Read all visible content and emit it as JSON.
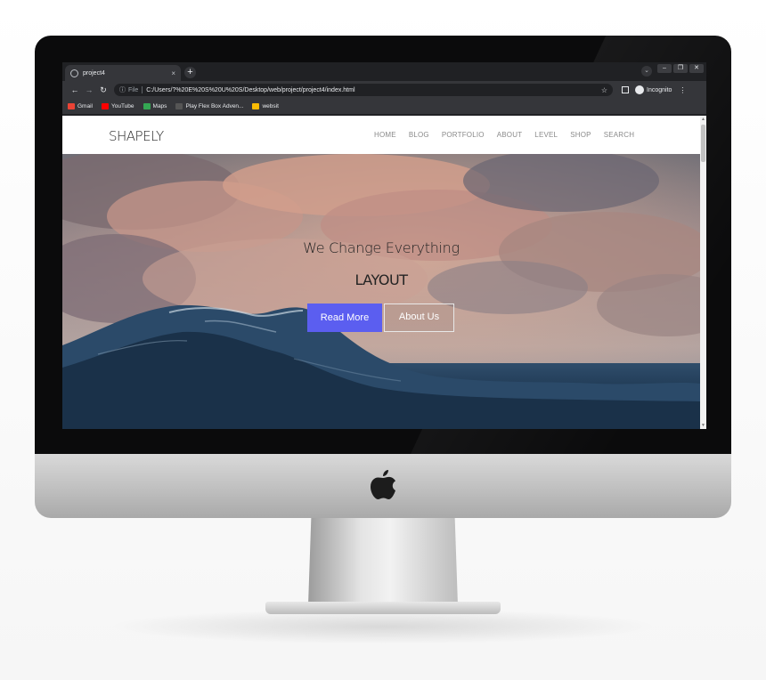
{
  "browser": {
    "tab_title": "project4",
    "tab_close": "×",
    "new_tab": "+",
    "file_label": "File",
    "url": "C:/Users/?%20E%20S%20U%20S/Desktop/web/project/project4/index.html",
    "profile_label": "Incognito",
    "bookmarks": [
      {
        "label": "Gmail",
        "color": "#ea4335"
      },
      {
        "label": "YouTube",
        "color": "#ff0000"
      },
      {
        "label": "Maps",
        "color": "#34a853"
      },
      {
        "label": "Play Flex Box Adven...",
        "color": "#3b3b3b"
      },
      {
        "label": "websit",
        "color": "#fbbc04"
      }
    ]
  },
  "site": {
    "logo": "SHAPELY",
    "nav": [
      "HOME",
      "BLOG",
      "PORTFOLIO",
      "ABOUT",
      "LEVEL",
      "SHOP",
      "SEARCH"
    ],
    "hero": {
      "heading": "We Change Everything",
      "subheading": "LAYOUT",
      "primary_button": "Read More",
      "secondary_button": "About Us"
    }
  },
  "colors": {
    "accent": "#5b5ef0",
    "browser_dark": "#202124",
    "browser_toolbar": "#35363a"
  }
}
